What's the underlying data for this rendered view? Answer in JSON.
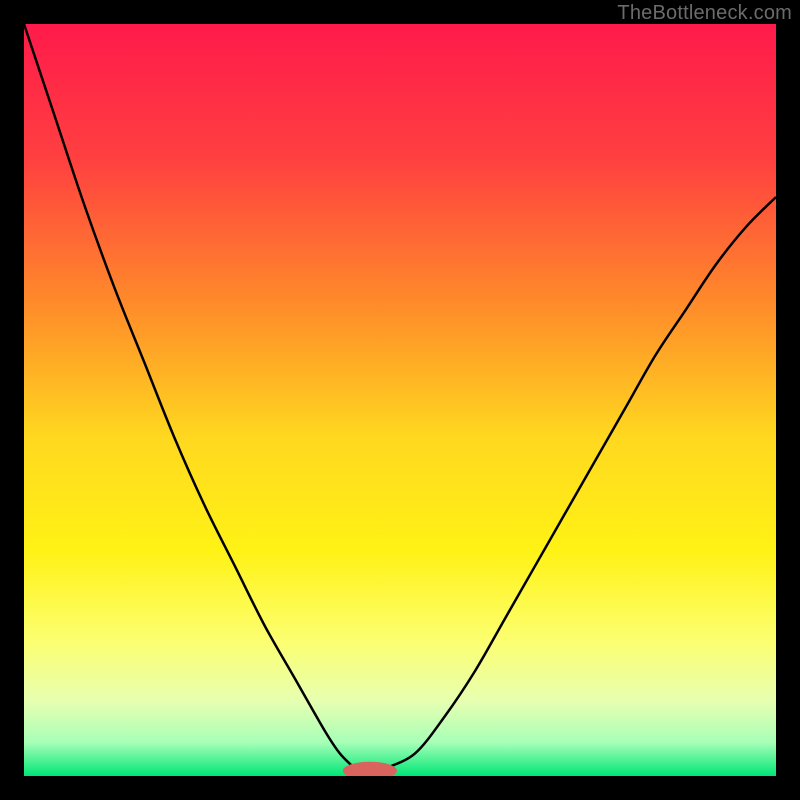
{
  "watermark": "TheBottleneck.com",
  "chart_data": {
    "type": "line",
    "title": "",
    "xlabel": "",
    "ylabel": "",
    "xlim": [
      0,
      100
    ],
    "ylim": [
      0,
      100
    ],
    "grid": false,
    "legend": false,
    "background_gradient_stops": [
      {
        "pos": 0.0,
        "color": "#ff1a4b"
      },
      {
        "pos": 0.18,
        "color": "#ff4040"
      },
      {
        "pos": 0.37,
        "color": "#ff8a2a"
      },
      {
        "pos": 0.55,
        "color": "#ffd81f"
      },
      {
        "pos": 0.7,
        "color": "#fff215"
      },
      {
        "pos": 0.82,
        "color": "#fcff70"
      },
      {
        "pos": 0.9,
        "color": "#e7ffb0"
      },
      {
        "pos": 0.955,
        "color": "#a8ffb8"
      },
      {
        "pos": 1.0,
        "color": "#00e676"
      }
    ],
    "series": [
      {
        "name": "left-curve",
        "x": [
          0,
          4,
          8,
          12,
          16,
          20,
          24,
          28,
          32,
          36,
          40,
          42,
          44
        ],
        "y": [
          100,
          88,
          76,
          65,
          55,
          45,
          36,
          28,
          20,
          13,
          6,
          3,
          1
        ]
      },
      {
        "name": "right-curve",
        "x": [
          48,
          52,
          56,
          60,
          64,
          68,
          72,
          76,
          80,
          84,
          88,
          92,
          96,
          100
        ],
        "y": [
          1,
          3,
          8,
          14,
          21,
          28,
          35,
          42,
          49,
          56,
          62,
          68,
          73,
          77
        ]
      }
    ],
    "marker": {
      "name": "bottleneck-marker",
      "cx": 46,
      "cy": 0.7,
      "rx": 3.6,
      "ry": 1.2,
      "color": "#d9635d"
    }
  }
}
